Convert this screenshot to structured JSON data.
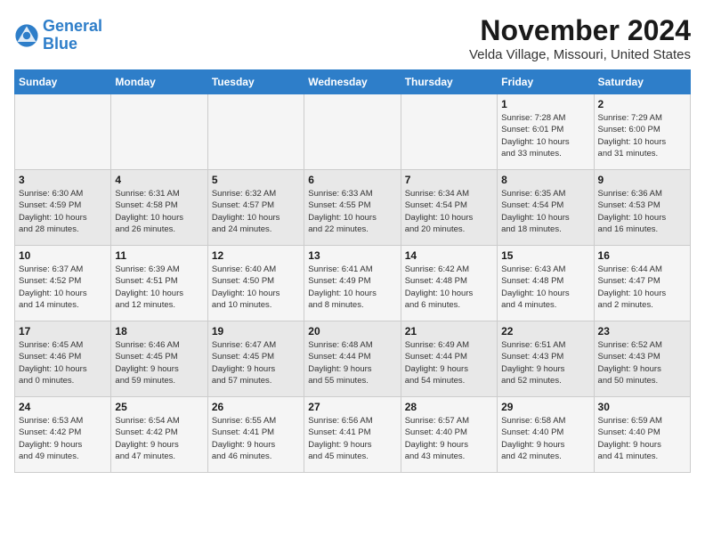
{
  "logo": {
    "line1": "General",
    "line2": "Blue"
  },
  "title": "November 2024",
  "subtitle": "Velda Village, Missouri, United States",
  "days_of_week": [
    "Sunday",
    "Monday",
    "Tuesday",
    "Wednesday",
    "Thursday",
    "Friday",
    "Saturday"
  ],
  "weeks": [
    [
      {
        "day": "",
        "detail": ""
      },
      {
        "day": "",
        "detail": ""
      },
      {
        "day": "",
        "detail": ""
      },
      {
        "day": "",
        "detail": ""
      },
      {
        "day": "",
        "detail": ""
      },
      {
        "day": "1",
        "detail": "Sunrise: 7:28 AM\nSunset: 6:01 PM\nDaylight: 10 hours\nand 33 minutes."
      },
      {
        "day": "2",
        "detail": "Sunrise: 7:29 AM\nSunset: 6:00 PM\nDaylight: 10 hours\nand 31 minutes."
      }
    ],
    [
      {
        "day": "3",
        "detail": "Sunrise: 6:30 AM\nSunset: 4:59 PM\nDaylight: 10 hours\nand 28 minutes."
      },
      {
        "day": "4",
        "detail": "Sunrise: 6:31 AM\nSunset: 4:58 PM\nDaylight: 10 hours\nand 26 minutes."
      },
      {
        "day": "5",
        "detail": "Sunrise: 6:32 AM\nSunset: 4:57 PM\nDaylight: 10 hours\nand 24 minutes."
      },
      {
        "day": "6",
        "detail": "Sunrise: 6:33 AM\nSunset: 4:55 PM\nDaylight: 10 hours\nand 22 minutes."
      },
      {
        "day": "7",
        "detail": "Sunrise: 6:34 AM\nSunset: 4:54 PM\nDaylight: 10 hours\nand 20 minutes."
      },
      {
        "day": "8",
        "detail": "Sunrise: 6:35 AM\nSunset: 4:54 PM\nDaylight: 10 hours\nand 18 minutes."
      },
      {
        "day": "9",
        "detail": "Sunrise: 6:36 AM\nSunset: 4:53 PM\nDaylight: 10 hours\nand 16 minutes."
      }
    ],
    [
      {
        "day": "10",
        "detail": "Sunrise: 6:37 AM\nSunset: 4:52 PM\nDaylight: 10 hours\nand 14 minutes."
      },
      {
        "day": "11",
        "detail": "Sunrise: 6:39 AM\nSunset: 4:51 PM\nDaylight: 10 hours\nand 12 minutes."
      },
      {
        "day": "12",
        "detail": "Sunrise: 6:40 AM\nSunset: 4:50 PM\nDaylight: 10 hours\nand 10 minutes."
      },
      {
        "day": "13",
        "detail": "Sunrise: 6:41 AM\nSunset: 4:49 PM\nDaylight: 10 hours\nand 8 minutes."
      },
      {
        "day": "14",
        "detail": "Sunrise: 6:42 AM\nSunset: 4:48 PM\nDaylight: 10 hours\nand 6 minutes."
      },
      {
        "day": "15",
        "detail": "Sunrise: 6:43 AM\nSunset: 4:48 PM\nDaylight: 10 hours\nand 4 minutes."
      },
      {
        "day": "16",
        "detail": "Sunrise: 6:44 AM\nSunset: 4:47 PM\nDaylight: 10 hours\nand 2 minutes."
      }
    ],
    [
      {
        "day": "17",
        "detail": "Sunrise: 6:45 AM\nSunset: 4:46 PM\nDaylight: 10 hours\nand 0 minutes."
      },
      {
        "day": "18",
        "detail": "Sunrise: 6:46 AM\nSunset: 4:45 PM\nDaylight: 9 hours\nand 59 minutes."
      },
      {
        "day": "19",
        "detail": "Sunrise: 6:47 AM\nSunset: 4:45 PM\nDaylight: 9 hours\nand 57 minutes."
      },
      {
        "day": "20",
        "detail": "Sunrise: 6:48 AM\nSunset: 4:44 PM\nDaylight: 9 hours\nand 55 minutes."
      },
      {
        "day": "21",
        "detail": "Sunrise: 6:49 AM\nSunset: 4:44 PM\nDaylight: 9 hours\nand 54 minutes."
      },
      {
        "day": "22",
        "detail": "Sunrise: 6:51 AM\nSunset: 4:43 PM\nDaylight: 9 hours\nand 52 minutes."
      },
      {
        "day": "23",
        "detail": "Sunrise: 6:52 AM\nSunset: 4:43 PM\nDaylight: 9 hours\nand 50 minutes."
      }
    ],
    [
      {
        "day": "24",
        "detail": "Sunrise: 6:53 AM\nSunset: 4:42 PM\nDaylight: 9 hours\nand 49 minutes."
      },
      {
        "day": "25",
        "detail": "Sunrise: 6:54 AM\nSunset: 4:42 PM\nDaylight: 9 hours\nand 47 minutes."
      },
      {
        "day": "26",
        "detail": "Sunrise: 6:55 AM\nSunset: 4:41 PM\nDaylight: 9 hours\nand 46 minutes."
      },
      {
        "day": "27",
        "detail": "Sunrise: 6:56 AM\nSunset: 4:41 PM\nDaylight: 9 hours\nand 45 minutes."
      },
      {
        "day": "28",
        "detail": "Sunrise: 6:57 AM\nSunset: 4:40 PM\nDaylight: 9 hours\nand 43 minutes."
      },
      {
        "day": "29",
        "detail": "Sunrise: 6:58 AM\nSunset: 4:40 PM\nDaylight: 9 hours\nand 42 minutes."
      },
      {
        "day": "30",
        "detail": "Sunrise: 6:59 AM\nSunset: 4:40 PM\nDaylight: 9 hours\nand 41 minutes."
      }
    ]
  ],
  "colors": {
    "header_bg": "#2e7ec9",
    "header_text": "#ffffff",
    "odd_row": "#f5f5f5",
    "even_row": "#e8e8e8"
  }
}
